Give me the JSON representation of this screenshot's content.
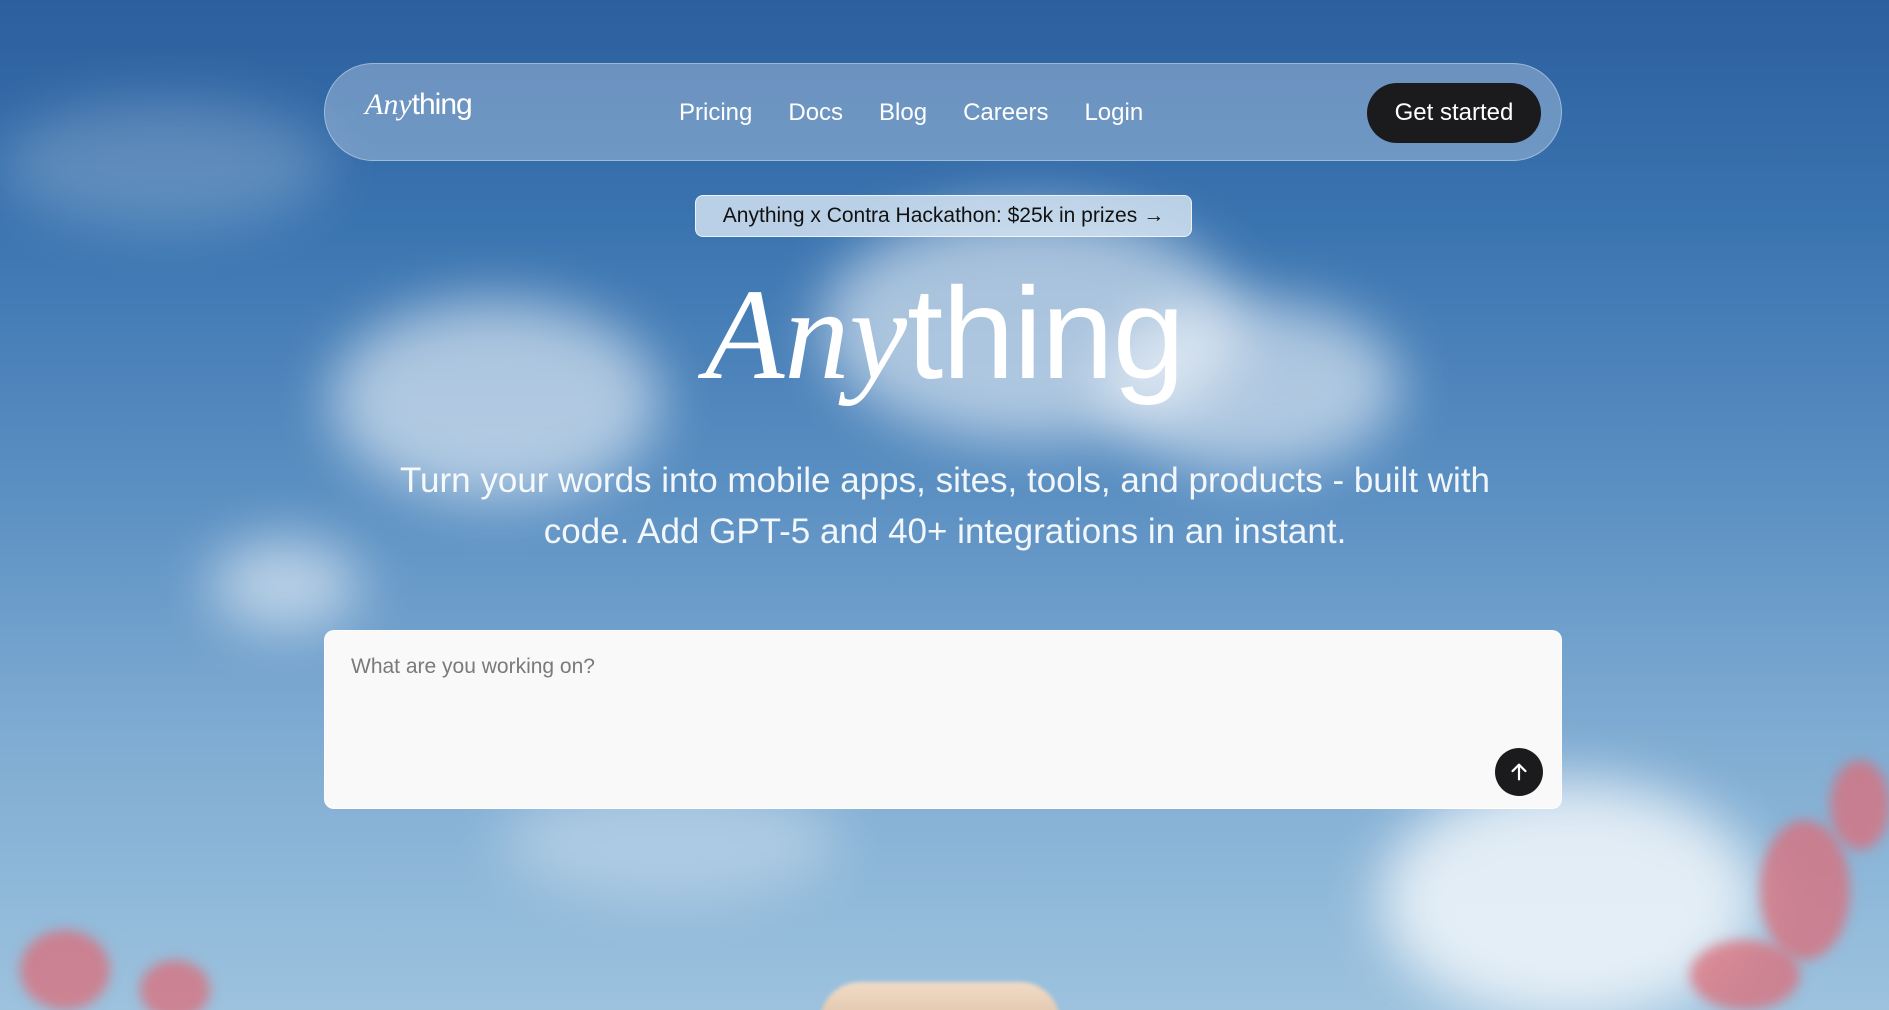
{
  "brand": {
    "logo_italic": "Any",
    "logo_plain": "thing"
  },
  "nav": {
    "links": [
      "Pricing",
      "Docs",
      "Blog",
      "Careers",
      "Login"
    ],
    "cta_label": "Get started"
  },
  "announcement": {
    "text": "Anything x Contra Hackathon: $25k in prizes",
    "arrow": "→"
  },
  "hero": {
    "logo_italic": "Any",
    "logo_plain": "thing",
    "subtitle": "Turn your words into mobile apps, sites, tools, and products - built with code. Add GPT-5 and 40+ integrations in an instant."
  },
  "prompt": {
    "placeholder": "What are you working on?",
    "value": ""
  },
  "icons": {
    "submit": "arrow-up-icon",
    "announcement": "arrow-right-icon"
  },
  "colors": {
    "cta_background": "#1b1b1d",
    "text_on_sky": "#ffffff",
    "prompt_background": "#f9f9f9"
  }
}
